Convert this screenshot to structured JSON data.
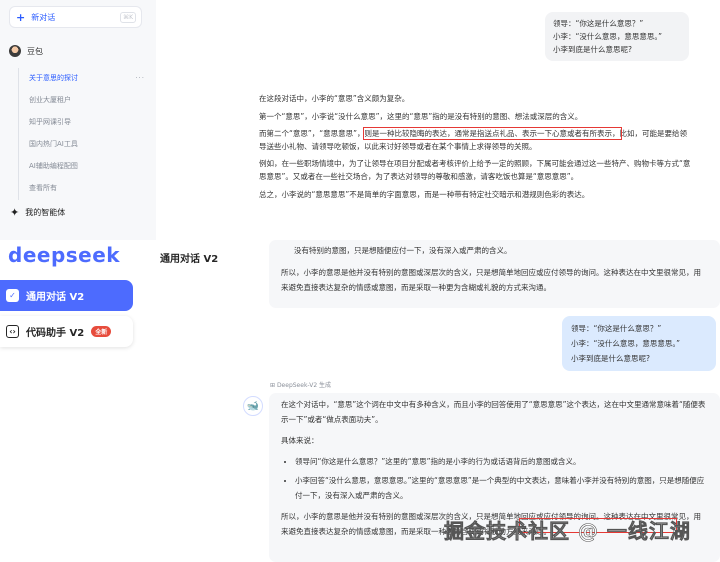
{
  "doubao": {
    "new_chat": "新对话",
    "new_chat_shortcut": "⌘K",
    "user_name": "豆包",
    "history": [
      {
        "label": "关于意思的探讨",
        "active": true
      },
      {
        "label": "创业大厦租户"
      },
      {
        "label": "知乎网课引导"
      },
      {
        "label": "国内热门AI工具"
      },
      {
        "label": "AI辅助编程配图"
      },
      {
        "label": "查看所有"
      }
    ],
    "agents": "我的智能体",
    "question_lines": [
      "领导：“你这是什么意思？”",
      "小李：“没什么意思，意思意思。”",
      "小李到底是什么意思呢?"
    ],
    "answer": {
      "p1": "在这段对话中，小李的“意思”含义颇为复杂。",
      "p2": "第一个“意思”，小李说“没什么意思”，这里的“意思”指的是没有特别的意图、想法或深层的含义。",
      "p3_a": "而第二个“意思”，“意思意思”，",
      "p3_highlight": "则是一种比较隐晦的表达，通常是指送点礼品、表示一下心意或者有所表示，",
      "p3_b": "比如，可能是要给领导送些小礼物、请领导吃顿饭，以此来讨好领导或者在某个事情上求得领导的关照。",
      "p4": "例如，在一些职场情境中，为了让领导在项目分配或者考核评价上给予一定的照顾，下属可能会通过这一些特产、购物卡等方式“意思意思”。又或者在一些社交场合，为了表达对领导的尊敬和感激，请客吃饭也算是“意思意思”。",
      "p5": "总之，小李说的“意思意思”不是简单的字面意思，而是一种带有特定社交暗示和潜规则色彩的表达。"
    }
  },
  "deepseek": {
    "logo": "deepseek",
    "nav": [
      {
        "label": "通用对话 V2",
        "active": true,
        "icon": "chat-icon"
      },
      {
        "label": "代码助手 V2",
        "badge": "全新",
        "icon": "code-icon"
      }
    ],
    "page_title": "通用对话 V2",
    "prev_answer": {
      "tail": "没有特别的意图，只是想随便应付一下，没有深入或严肃的含义。",
      "conclusion": "所以，小李的意思是他并没有特别的意图或深层次的含义，只是想简单地回应或应付领导的询问。这种表达在中文里很常见，用来避免直接表达复杂的情感或意图，而是采取一种更为含糊或礼貌的方式来沟通。"
    },
    "question_lines": [
      "领导：“你这是什么意思？”",
      "小李：“没什么意思，意思意思。”",
      "小李到底是什么意思呢?"
    ],
    "model_label": "DeepSeek-V2 生成",
    "answer": {
      "intro": "在这个对话中，“意思”这个词在中文中有多种含义，而且小李的回答使用了“意思意思”这个表达，这在中文里通常意味着“随便表示一下”或者“做点表面功夫”。",
      "detail_heading": "具体来说：",
      "bullets": [
        "领导问“你这是什么意思？”这里的“意思”指的是小李的行为或话语背后的意图或含义。",
        "小李回答“没什么意思，意思意思。”这里的“意思意思”是一个典型的中文表达，意味着小李并没有特别的意图，只是想随便应付一下，没有深入或严肃的含义。"
      ],
      "conclusion": "所以，小李的意思是他并没有特别的意图或深层次的含义，只是想简单地回应或应付领导的询问。这种表达在中文里很常见，用来避免直接表达复杂的情感或意图，而是采取一种更为含糊或礼貌的方式来沟通。"
    }
  },
  "watermark": "掘金技术社区 @ 一线江湖",
  "colors": {
    "deepseek_blue": "#4d6bfe",
    "doubao_blue": "#2b5cff",
    "highlight_red": "#e53935"
  }
}
